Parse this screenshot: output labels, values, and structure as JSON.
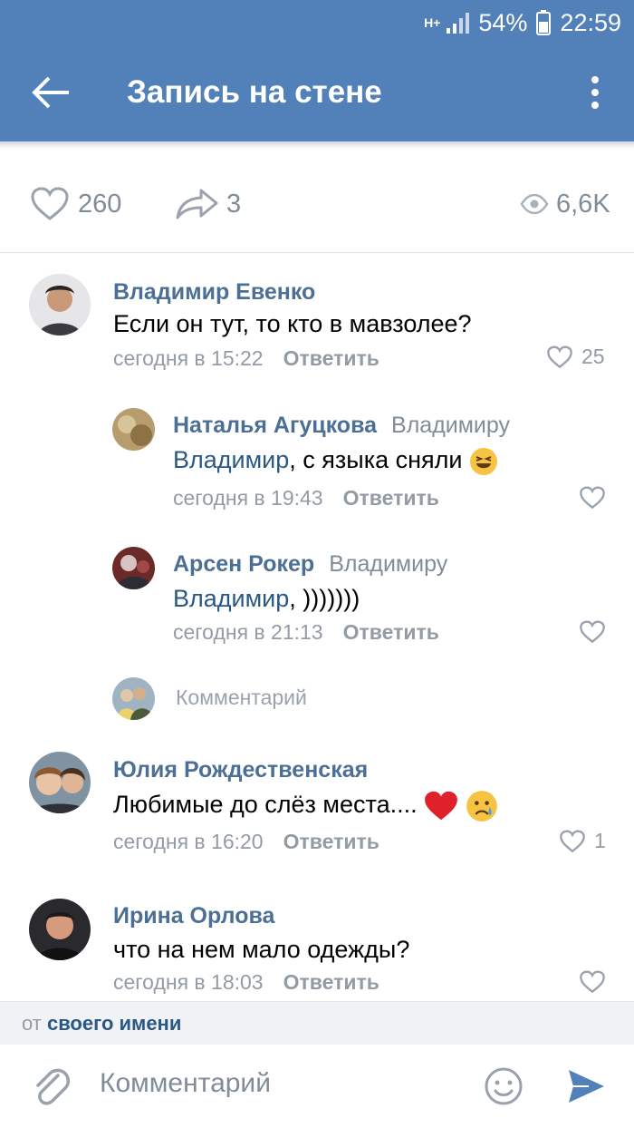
{
  "status_bar": {
    "network": "H+",
    "battery": "54%",
    "time": "22:59"
  },
  "header": {
    "title": "Запись на стене"
  },
  "post_stats": {
    "likes": "260",
    "shares": "3",
    "views": "6,6K"
  },
  "comments": [
    {
      "author": "Владимир Евенко",
      "text": "Если он тут, то кто в мавзолее?",
      "time": "сегодня в 15:22",
      "reply_label": "Ответить",
      "likes": "25"
    },
    {
      "author": "Наталья Агуцкова",
      "reply_to": "Владимиру",
      "mention": "Владимир",
      "text": ", с языка сняли",
      "time": "сегодня в 19:43",
      "reply_label": "Ответить",
      "likes": ""
    },
    {
      "author": "Арсен Рокер",
      "reply_to": "Владимиру",
      "mention": "Владимир",
      "text": ", )))))))",
      "time": "сегодня в 21:13",
      "reply_label": "Ответить",
      "likes": ""
    },
    {
      "author": "Юлия Рождественская",
      "text": "Любимые до слёз места....",
      "time": "сегодня в 16:20",
      "reply_label": "Ответить",
      "likes": "1"
    },
    {
      "author": "Ирина Орлова",
      "text": "что на нем мало одежды?",
      "time": "сегодня в 18:03",
      "reply_label": "Ответить",
      "likes": ""
    }
  ],
  "thread_comment_placeholder": "Комментарий",
  "footer": {
    "prefix": "от",
    "identity": "своего имени"
  },
  "composer": {
    "placeholder": "Комментарий"
  },
  "colors": {
    "header": "#5181b8",
    "link": "#2a5885",
    "name": "#4c6f96",
    "muted": "#939ba5"
  }
}
